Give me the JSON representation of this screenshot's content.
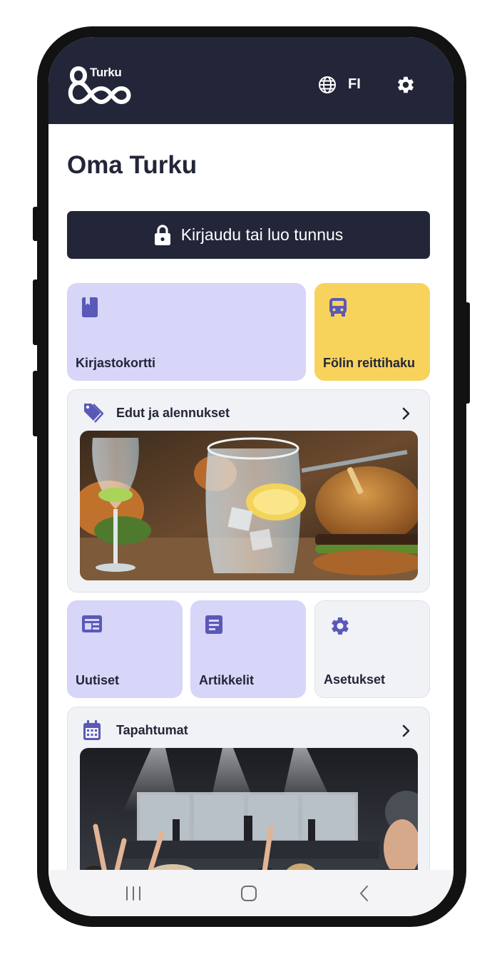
{
  "colors": {
    "header_bg": "#232539",
    "accent_purple": "#5a59b8",
    "card_purple": "#d7d5f8",
    "card_yellow": "#f7d35c",
    "card_grey": "#f0f2f6",
    "text_dark": "#232539"
  },
  "header": {
    "logo_text": "Turku",
    "language_icon": "globe-icon",
    "language_code": "FI",
    "settings_icon": "gear-icon"
  },
  "page": {
    "title": "Oma Turku"
  },
  "login": {
    "icon": "lock-icon",
    "label": "Kirjaudu tai luo tunnus"
  },
  "tiles_row1": [
    {
      "icon": "book-icon",
      "label": "Kirjastokortti"
    },
    {
      "icon": "bus-icon",
      "label": "Fölin reittihaku"
    }
  ],
  "benefits": {
    "icon": "tag-icon",
    "title": "Edut ja alennukset",
    "chevron_icon": "chevron-right-icon",
    "image": "drinks-and-burger-photo"
  },
  "tiles_row2": [
    {
      "icon": "news-icon",
      "label": "Uutiset"
    },
    {
      "icon": "article-icon",
      "label": "Artikkelit"
    },
    {
      "icon": "gear-icon",
      "label": "Asetukset"
    }
  ],
  "events": {
    "icon": "calendar-icon",
    "title": "Tapahtumat",
    "chevron_icon": "chevron-right-icon",
    "image": "concert-crowd-photo"
  },
  "system_nav": {
    "recents_icon": "recents-icon",
    "home_icon": "home-icon",
    "back_icon": "back-icon"
  }
}
